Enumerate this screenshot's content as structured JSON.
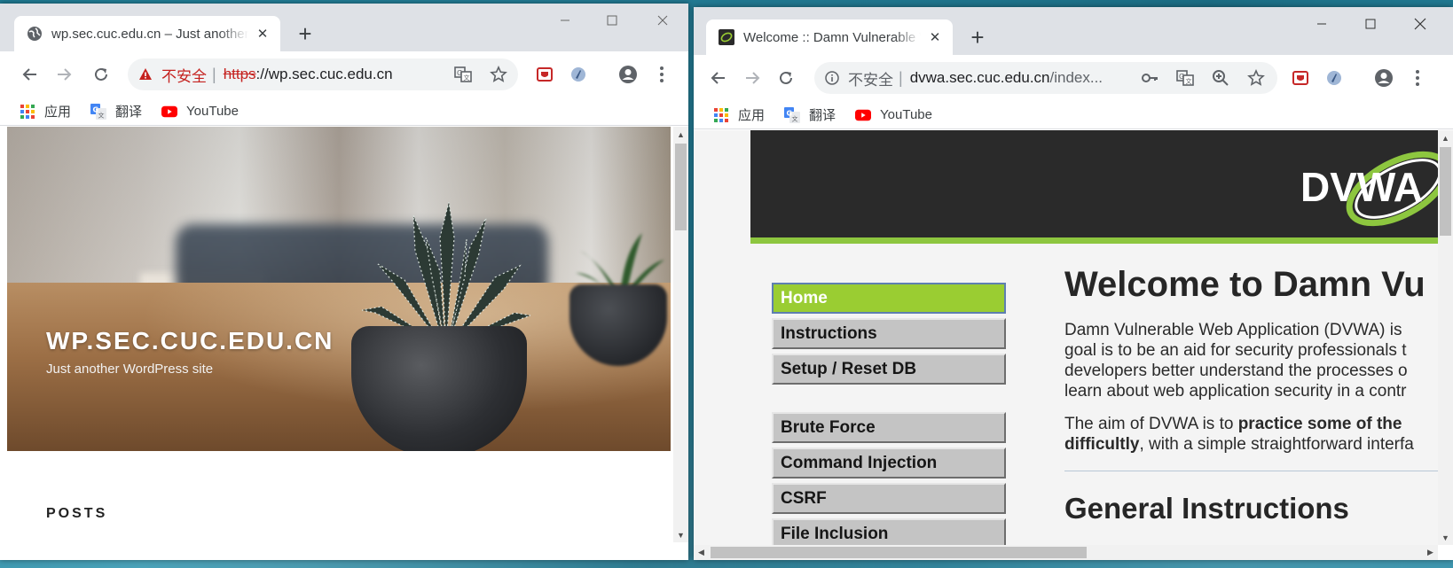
{
  "left_window": {
    "tab_title": "wp.sec.cuc.edu.cn – Just another WordPress site",
    "url_warning": "不安全",
    "url_scheme": "https",
    "url_rest": "://wp.sec.cuc.edu.cn",
    "bookmarks": [
      "应用",
      "翻译",
      "YouTube"
    ],
    "site_title": "WP.SEC.CUC.EDU.CN",
    "tagline": "Just another WordPress site",
    "section_heading": "POSTS"
  },
  "right_window": {
    "tab_title": "Welcome :: Damn Vulnerable Web Application",
    "url_info": "不安全",
    "url_host": "dvwa.sec.cuc.edu.cn",
    "url_path": "/index...",
    "bookmarks": [
      "应用",
      "翻译",
      "YouTube"
    ],
    "logo_text": "DVWA",
    "menu": [
      "Home",
      "Instructions",
      "Setup / Reset DB",
      "Brute Force",
      "Command Injection",
      "CSRF",
      "File Inclusion"
    ],
    "heading": "Welcome to Damn Vu",
    "intro_lines": [
      "Damn Vulnerable Web Application (DVWA) is",
      "goal is to be an aid for security professionals t",
      "developers better understand the processes o",
      "learn about web application security in a contr"
    ],
    "aim_prefix": "The aim of DVWA is to ",
    "aim_bold": "practice some of the",
    "aim_bold2": "difficultly",
    "aim_suffix": ", with a simple straightforward interfa",
    "subheading": "General Instructions"
  },
  "colors": {
    "dvwa_green": "#9acd32",
    "dvwa_header": "#2a2a2a",
    "insecure_red": "#c5221f",
    "tabbar": "#dee1e6"
  }
}
